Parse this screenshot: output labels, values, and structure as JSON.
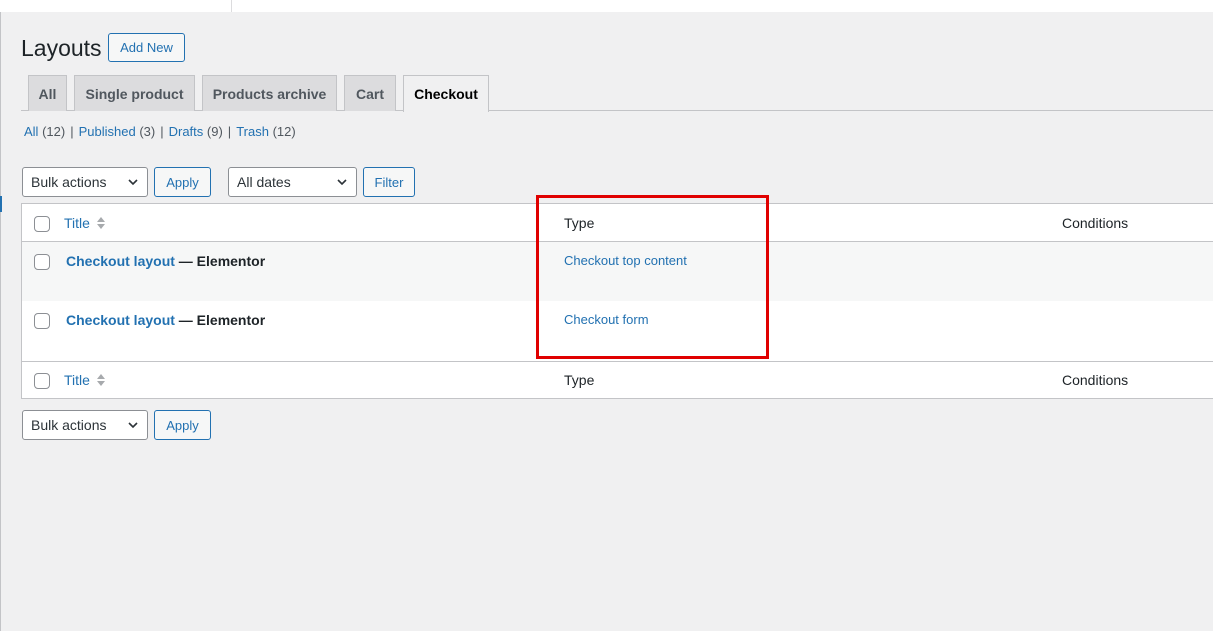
{
  "page": {
    "title": "Layouts",
    "add_new_label": "Add New"
  },
  "tabs": [
    {
      "label": "All",
      "active": false
    },
    {
      "label": "Single product",
      "active": false
    },
    {
      "label": "Products archive",
      "active": false
    },
    {
      "label": "Cart",
      "active": false
    },
    {
      "label": "Checkout",
      "active": true
    }
  ],
  "views": {
    "all": {
      "label": "All",
      "count": "(12)"
    },
    "published": {
      "label": "Published",
      "count": "(3)"
    },
    "drafts": {
      "label": "Drafts",
      "count": "(9)"
    },
    "trash": {
      "label": "Trash",
      "count": "(12)"
    },
    "separator": "|"
  },
  "filters_top": {
    "bulk_actions": "Bulk actions",
    "apply_label": "Apply",
    "dates": "All dates",
    "filter_label": "Filter"
  },
  "filters_bottom": {
    "bulk_actions": "Bulk actions",
    "apply_label": "Apply"
  },
  "table": {
    "columns": {
      "title": "Title",
      "type": "Type",
      "conditions": "Conditions"
    },
    "rows": [
      {
        "title": "Checkout layout",
        "suffix": "— Elementor",
        "type": "Checkout top content"
      },
      {
        "title": "Checkout layout",
        "suffix": "— Elementor",
        "type": "Checkout form"
      }
    ]
  },
  "colors": {
    "accent": "#2271b1",
    "highlight": "#e00000",
    "background": "#f0f0f1"
  }
}
